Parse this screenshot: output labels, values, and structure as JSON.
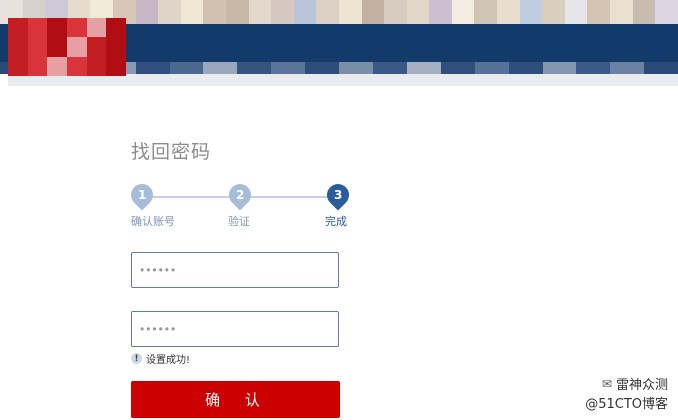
{
  "page": {
    "title": "找回密码"
  },
  "steps": [
    {
      "number": "1",
      "label": "确认账号"
    },
    {
      "number": "2",
      "label": "验证"
    },
    {
      "number": "3",
      "label": "完成"
    }
  ],
  "form": {
    "password_value": "••••••",
    "confirm_password_value": "••••••",
    "notice_icon": "!",
    "notice_text": "设置成功!",
    "confirm_label": "确 认"
  },
  "watermark": {
    "line1": "雷神众测",
    "line2": "@51CTO博客"
  },
  "colors": {
    "header_navy": "#123a6b",
    "step_active": "#2c5d9a",
    "step_inactive": "#a7bcd9",
    "button_red": "#cc0000"
  }
}
